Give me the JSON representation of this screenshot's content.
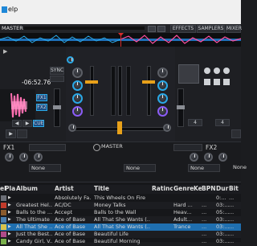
{
  "menu": {
    "help": "elp"
  },
  "topbar": {
    "master_label": "MASTER",
    "tabs": [
      "EFFECTS",
      "SAMPLERS",
      "MIXER"
    ]
  },
  "deck_left": {
    "remain_time": "-06:52.76",
    "sync_label": "SYNC",
    "fx1": "FX1",
    "fx2": "FX2",
    "cue": "CUE"
  },
  "mixer": {
    "master_label": "MASTER"
  },
  "deck_right": {
    "stepper_value_1": "4",
    "stepper_value_2": "4"
  },
  "effects": {
    "fx1_label": "FX1",
    "fx2_label": "FX2",
    "fx1_select": "None",
    "fx2_select": "None",
    "fx1b_select": "None",
    "fx2b_select": "None"
  },
  "browser": {
    "columns": [
      "Preview",
      "Pla",
      "Album",
      "Artist",
      "Title",
      "Rating",
      "Genre",
      "Key",
      "BPM",
      "Dur",
      "Bitrate"
    ],
    "column_labels": [
      "el",
      "Pla",
      "Album",
      "Artist",
      "Title",
      "Ratinc",
      "Genre",
      "Ke",
      "BPN",
      "Dur",
      "Bit"
    ],
    "rows": [
      {
        "album": "",
        "artist": "Absolutely Fa...",
        "title": "This Wheels On Fire",
        "genre": "",
        "key": "",
        "bpm": "",
        "dur": "0:...",
        "bit": "..."
      },
      {
        "album": "Greatest Hel...",
        "artist": "AC/DC",
        "title": "Money Talks",
        "genre": "Hard ...",
        "key": "",
        "bpm": "...",
        "dur": "03:...",
        "bit": "..."
      },
      {
        "album": "Balls to the ...",
        "artist": "Accept",
        "title": "Balls to the Wall",
        "genre": "Heav...",
        "key": "",
        "bpm": "...",
        "dur": "05:...",
        "bit": "..."
      },
      {
        "album": "The Ultimate ...",
        "artist": "Ace of Base",
        "title": "All That She Wants (...",
        "genre": "Adult...",
        "key": "",
        "bpm": "...",
        "dur": "03:...",
        "bit": "..."
      },
      {
        "album": "All That She ...",
        "artist": "Ace of Base",
        "title": "All That She Wants (...",
        "genre": "Trance",
        "key": "",
        "bpm": "...",
        "dur": "03:...",
        "bit": "..."
      },
      {
        "album": "Just the Best...",
        "artist": "Ace of Base",
        "title": "Beautiful Life",
        "genre": "",
        "key": "",
        "bpm": "...",
        "dur": "03:...",
        "bit": "..."
      },
      {
        "album": "Candy Girl, V...",
        "artist": "Ace of Base",
        "title": "Beautiful Morning",
        "genre": "",
        "key": "",
        "bpm": "...",
        "dur": "03:...",
        "bit": "..."
      }
    ]
  },
  "colors": {
    "accent": "#2aa8e6",
    "selected_row": "#1f6fb0",
    "playhead": "#d92b2b",
    "orange": "#e8a11a",
    "waveform_pink": "#ff4fa0"
  }
}
